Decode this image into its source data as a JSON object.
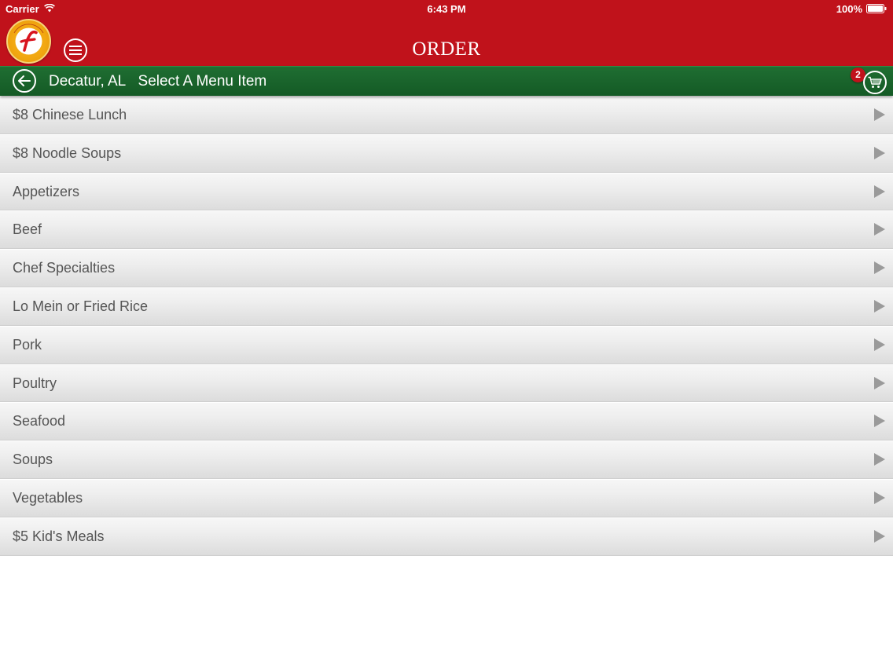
{
  "status_bar": {
    "carrier": "Carrier",
    "time": "6:43 PM",
    "battery": "100%"
  },
  "header": {
    "title": "ORDER",
    "menu_icon": "hamburger-menu-icon",
    "logo_icon": "restaurant-logo"
  },
  "subheader": {
    "location": "Decatur, AL",
    "instruction": "Select A Menu Item",
    "back_icon": "back-arrow-icon",
    "cart_icon": "cart-icon",
    "cart_count": "2"
  },
  "menu_items": [
    {
      "label": "$8 Chinese Lunch"
    },
    {
      "label": "$8 Noodle Soups"
    },
    {
      "label": "Appetizers"
    },
    {
      "label": "Beef"
    },
    {
      "label": "Chef Specialties"
    },
    {
      "label": "Lo Mein or Fried Rice"
    },
    {
      "label": "Pork"
    },
    {
      "label": "Poultry"
    },
    {
      "label": "Seafood"
    },
    {
      "label": "Soups"
    },
    {
      "label": "Vegetables"
    },
    {
      "label": "$5 Kid's Meals"
    }
  ],
  "colors": {
    "header_red": "#c0121b",
    "bar_green": "#1a6a2e",
    "item_text": "#555555",
    "chevron": "#9a9a9a"
  }
}
